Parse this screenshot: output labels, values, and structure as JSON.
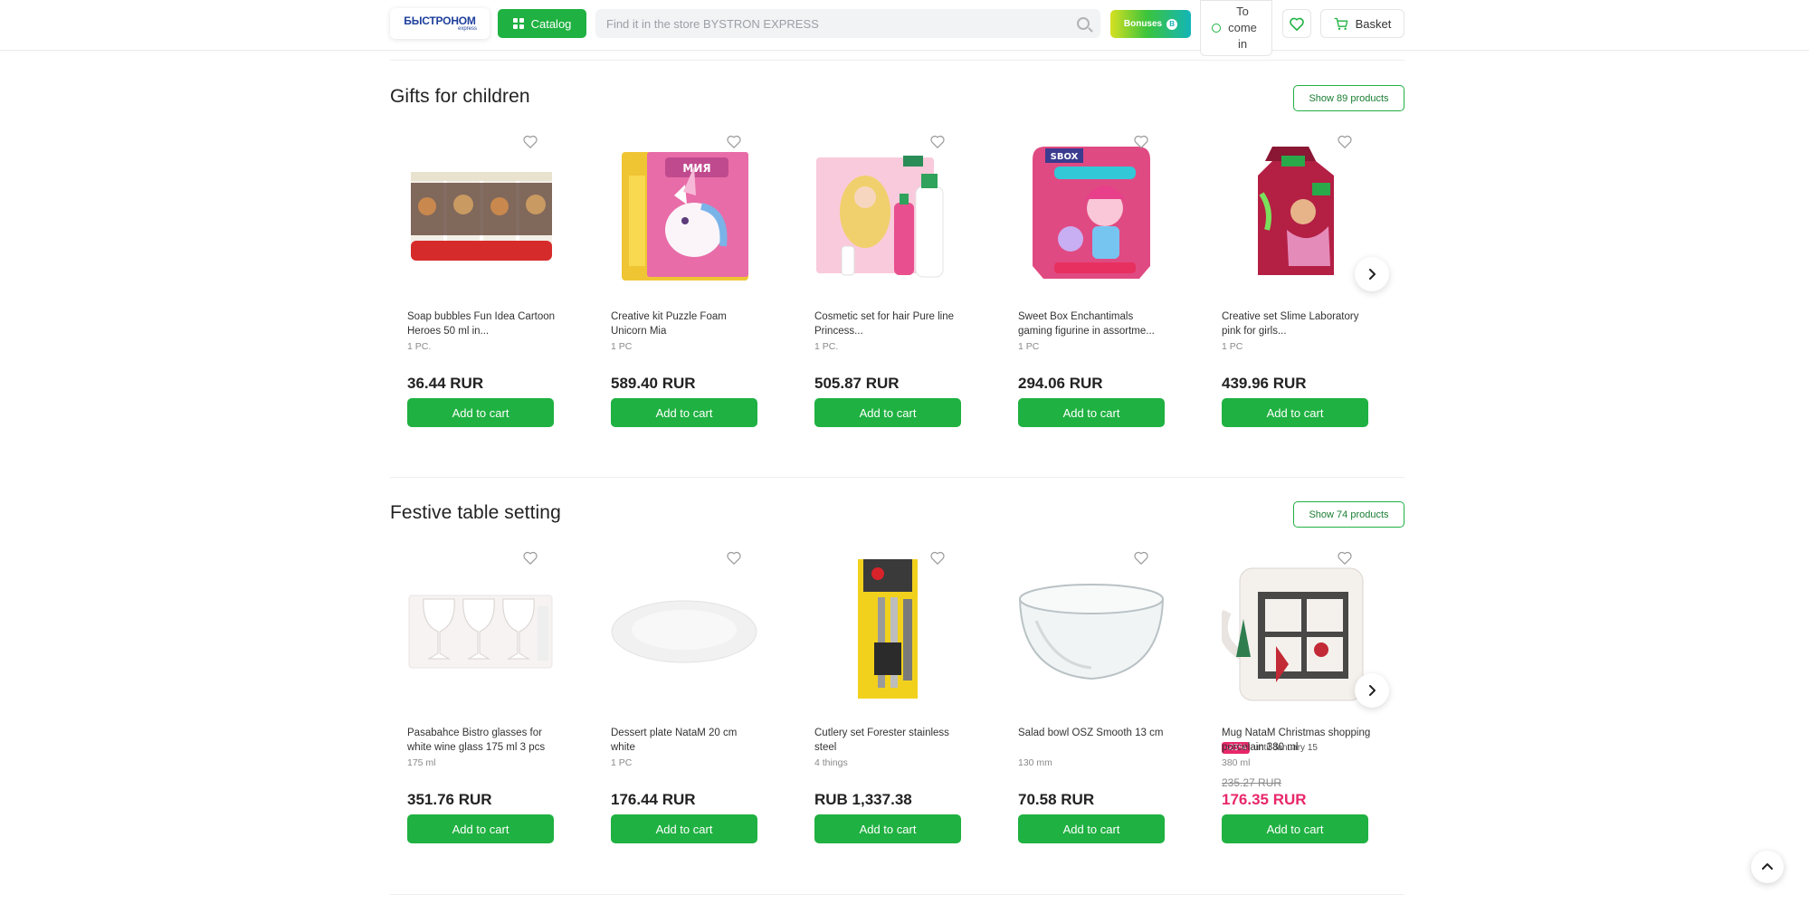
{
  "header": {
    "logo_text": "БЫСТРОНОМ",
    "logo_sub": "express",
    "catalog_label": "Catalog",
    "search_placeholder": "Find it in the store BYSTRON EXPRESS",
    "bonuses_label": "Bonuses",
    "login_label": "To come in",
    "basket_label": "Basket"
  },
  "sections": [
    {
      "title": "Gifts for children",
      "show_label": "Show 89 products",
      "products": [
        {
          "title": "Soap bubbles Fun Idea Cartoon Heroes 50 ml in...",
          "unit": "1 PC.",
          "price": "36.44 RUR",
          "button": "Add to cart"
        },
        {
          "title": "Creative kit Puzzle Foam Unicorn Mia",
          "unit": "1 PC",
          "price": "589.40 RUR",
          "button": "Add to cart"
        },
        {
          "title": "Cosmetic set for hair Pure line Princess...",
          "unit": "1 PC.",
          "price": "505.87 RUR",
          "button": "Add to cart"
        },
        {
          "title": "Sweet Box Enchantimals gaming figurine in assortme...",
          "unit": "1 PC",
          "price": "294.06 RUR",
          "button": "Add to cart"
        },
        {
          "title": "Creative set Slime Laboratory pink for girls...",
          "unit": "1 PC",
          "price": "439.96 RUR",
          "button": "Add to cart"
        }
      ]
    },
    {
      "title": "Festive table setting",
      "show_label": "Show 74 products",
      "products": [
        {
          "title": "Pasabahce Bistro glasses for white wine glass 175 ml 3 pcs",
          "unit": "175 ml",
          "price": "351.76 RUR",
          "button": "Add to cart"
        },
        {
          "title": "Dessert plate NataM 20 cm white",
          "unit": "1 PC",
          "price": "176.44 RUR",
          "button": "Add to cart"
        },
        {
          "title": "Cutlery set Forester stainless steel",
          "unit": "4 things",
          "price": "RUB 1,337.38",
          "button": "Add to cart"
        },
        {
          "title": "Salad bowl OSZ Smooth 13 cm",
          "unit": "130 mm",
          "price": "70.58 RUR",
          "button": "Add to cart"
        },
        {
          "title": "Mug NataM Christmas shopping porcelain 380 ml",
          "unit": "380 ml",
          "price": "176.35 RUR",
          "old_price": "235.27 RUR",
          "discount": "-25%",
          "discount_note": "until January 15",
          "button": "Add to cart"
        }
      ]
    }
  ],
  "colors": {
    "accent_green": "#1fb141",
    "sale_pink": "#e8276a",
    "brand_blue": "#1e3f9c"
  },
  "icons": [
    "catalog-grid-icon",
    "search-icon",
    "coin-icon",
    "user-icon",
    "heart-icon",
    "basket-icon",
    "chevron-right-icon",
    "chevron-up-icon"
  ]
}
